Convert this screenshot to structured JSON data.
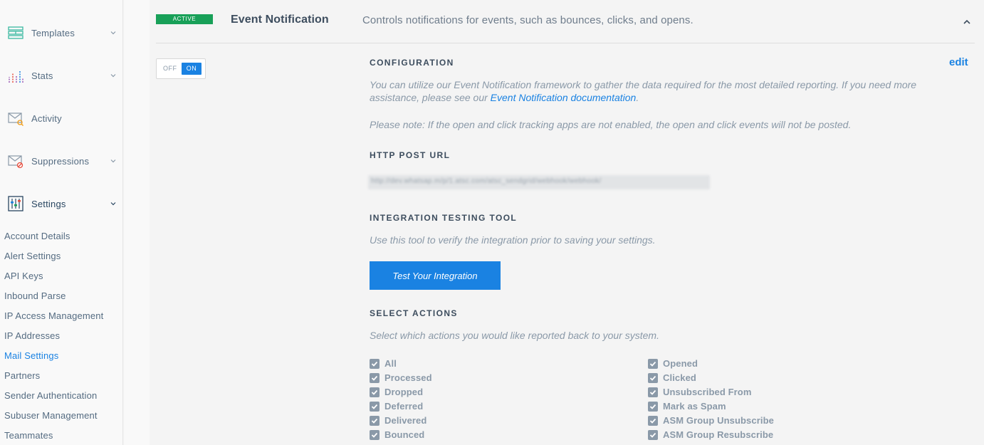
{
  "sidebar": {
    "nav": [
      {
        "label": "Templates",
        "icon": "templates-icon",
        "has_chevron": true
      },
      {
        "label": "Stats",
        "icon": "stats-icon",
        "has_chevron": true
      },
      {
        "label": "Activity",
        "icon": "activity-icon",
        "has_chevron": false
      },
      {
        "label": "Suppressions",
        "icon": "suppressions-icon",
        "has_chevron": true
      },
      {
        "label": "Settings",
        "icon": "settings-icon",
        "has_chevron": true
      }
    ],
    "settings_sub": [
      "Account Details",
      "Alert Settings",
      "API Keys",
      "Inbound Parse",
      "IP Access Management",
      "IP Addresses",
      "Mail Settings",
      "Partners",
      "Sender Authentication",
      "Subuser Management",
      "Teammates"
    ],
    "current_sub": "Mail Settings"
  },
  "header": {
    "badge": "ACTIVE",
    "title": "Event Notification",
    "subtitle": "Controls notifications for events, such as bounces, clicks, and opens."
  },
  "toggle": {
    "off_label": "OFF",
    "on_label": "ON",
    "state": "on"
  },
  "config": {
    "heading": "CONFIGURATION",
    "edit_label": "edit",
    "desc_before": "You can utilize our Event Notification framework to gather the data required for the most detailed reporting. If you need more assistance, please see our ",
    "desc_link": "Event Notification documentation",
    "desc_after": ".",
    "note": "Please note: If the open and click tracking apps are not enabled, the open and click events will not be posted."
  },
  "http_post": {
    "heading": "HTTP POST URL",
    "url": "http://dev.whatsap.m/p/1.atsc.com/atsc_sendgrid/webhook/webhook/"
  },
  "testing": {
    "heading": "INTEGRATION TESTING TOOL",
    "desc": "Use this tool to verify the integration prior to saving your settings.",
    "button": "Test Your Integration"
  },
  "actions": {
    "heading": "SELECT ACTIONS",
    "desc": "Select which actions you would like reported back to your system.",
    "left": [
      "All",
      "Processed",
      "Dropped",
      "Deferred",
      "Delivered",
      "Bounced"
    ],
    "right": [
      "Opened",
      "Clicked",
      "Unsubscribed From",
      "Mark as Spam",
      "ASM Group Unsubscribe",
      "ASM Group Resubscribe"
    ]
  },
  "colors": {
    "accent": "#1a82e2",
    "active_badge": "#18a058",
    "muted": "#8a99a8"
  }
}
